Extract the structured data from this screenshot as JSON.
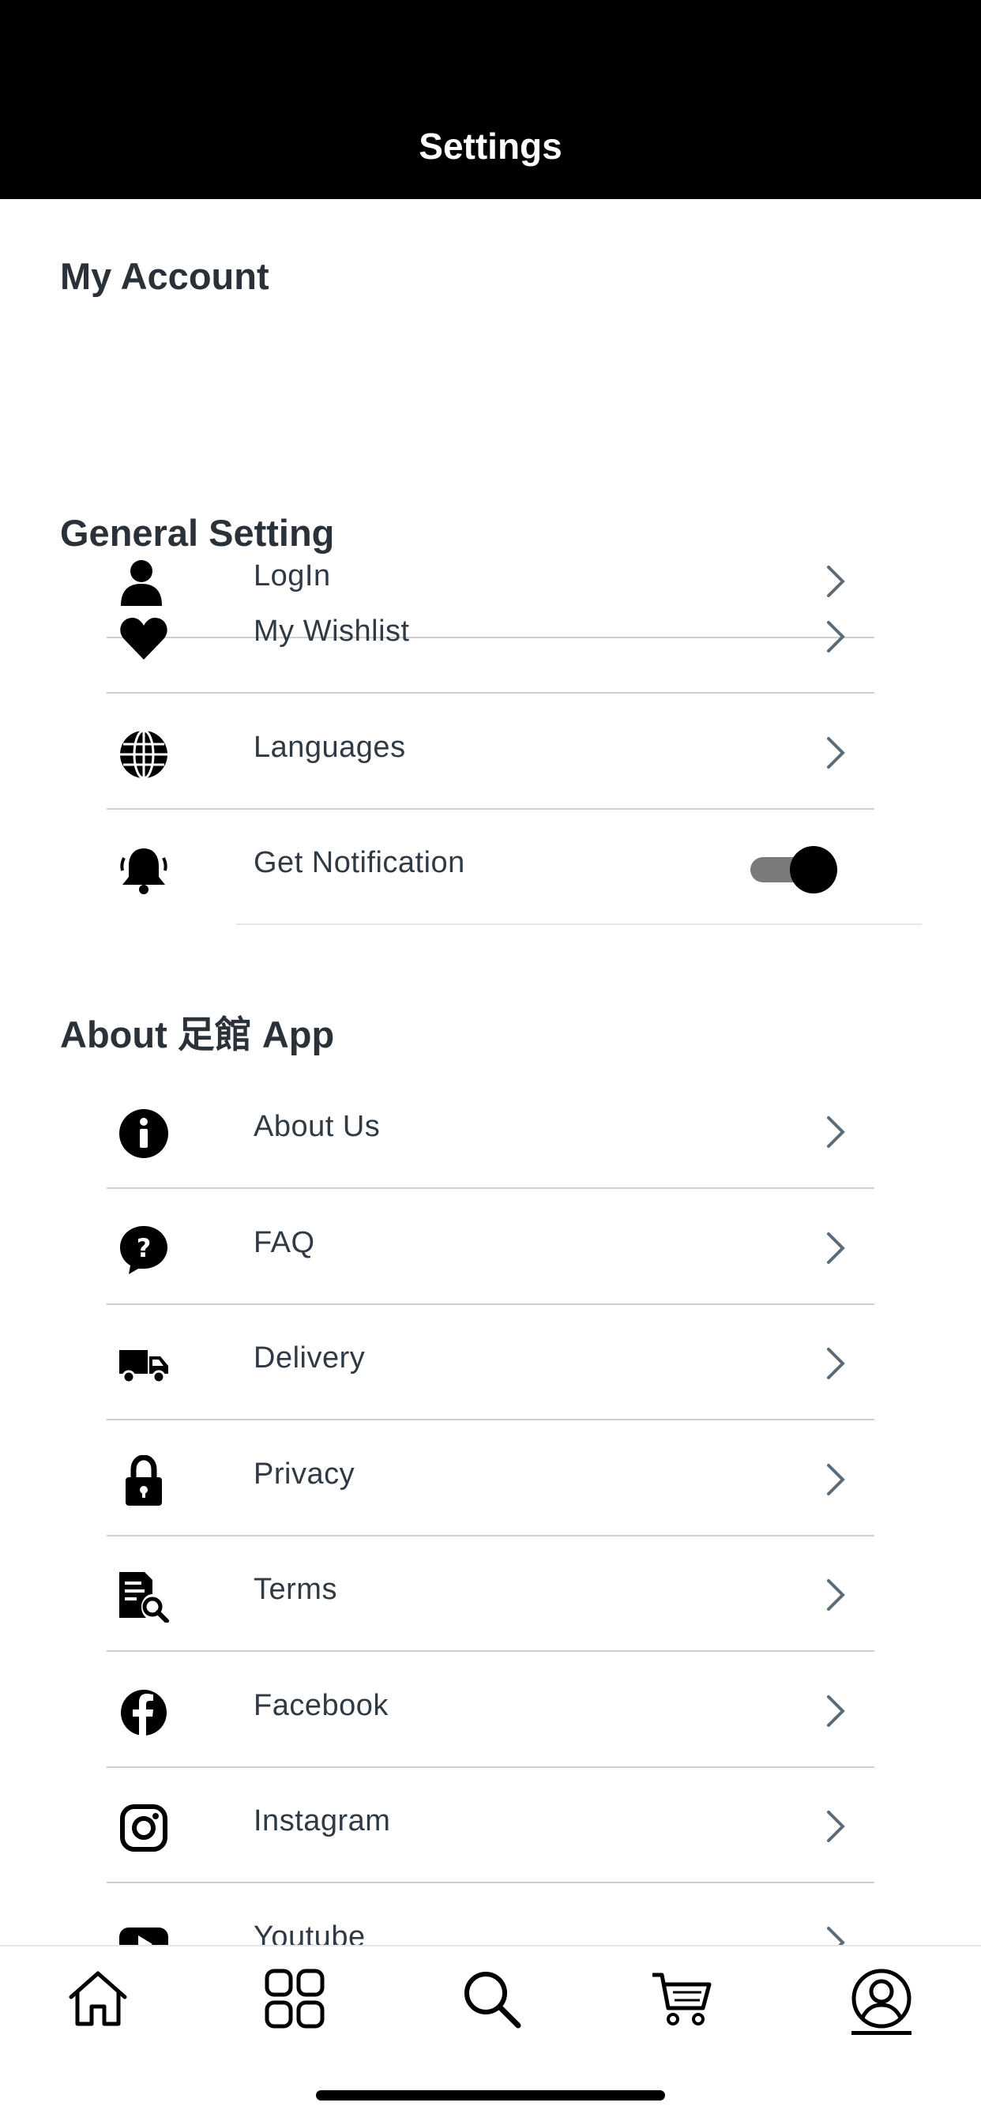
{
  "header": {
    "title": "Settings"
  },
  "sections": {
    "account": {
      "title": "My Account"
    },
    "general": {
      "title": "General Setting"
    },
    "about": {
      "title": "About 足館 App"
    }
  },
  "items": {
    "login": {
      "label": "LogIn",
      "icon": "user-icon"
    },
    "wishlist": {
      "label": "My Wishlist",
      "icon": "heart-icon"
    },
    "languages": {
      "label": "Languages",
      "icon": "globe-icon"
    },
    "notification": {
      "label": "Get Notification",
      "icon": "bell-icon",
      "enabled": true
    },
    "about_us": {
      "label": "About Us",
      "icon": "info-icon"
    },
    "faq": {
      "label": "FAQ",
      "icon": "question-icon"
    },
    "delivery": {
      "label": "Delivery",
      "icon": "truck-icon"
    },
    "privacy": {
      "label": "Privacy",
      "icon": "lock-icon"
    },
    "terms": {
      "label": "Terms",
      "icon": "document-search-icon"
    },
    "facebook": {
      "label": "Facebook",
      "icon": "facebook-icon"
    },
    "instagram": {
      "label": "Instagram",
      "icon": "instagram-icon"
    },
    "youtube": {
      "label": "Youtube",
      "icon": "youtube-icon"
    }
  },
  "tabbar": {
    "tabs": [
      "home-icon",
      "grid-icon",
      "search-icon",
      "cart-icon",
      "profile-icon"
    ],
    "active": "profile-icon"
  },
  "colors": {
    "header_bg": "#000000",
    "divider": "#cfcfcf",
    "text": "#2f3a44",
    "chevron": "#5b6b78"
  }
}
